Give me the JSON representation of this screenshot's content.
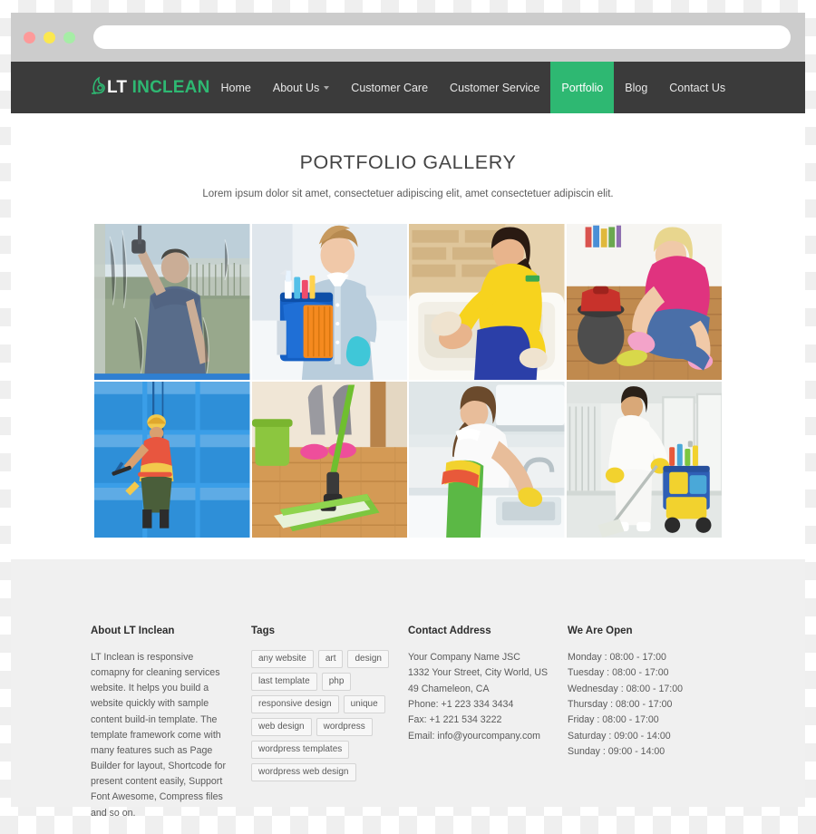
{
  "browser": {
    "dots": [
      "close-dot",
      "minimize-dot",
      "maximize-dot"
    ],
    "address_value": "",
    "address_placeholder": ""
  },
  "header": {
    "logo_icon": "vacuum-leaf-icon",
    "logo_primary": "LT",
    "logo_secondary": " INCLEAN",
    "accent_color": "#2eb872",
    "bar_color": "#3b3b3b",
    "nav": [
      {
        "label": "Home",
        "active": false,
        "dropdown": false
      },
      {
        "label": "About Us",
        "active": false,
        "dropdown": true
      },
      {
        "label": "Customer Care",
        "active": false,
        "dropdown": false
      },
      {
        "label": "Customer Service",
        "active": false,
        "dropdown": false
      },
      {
        "label": "Portfolio",
        "active": true,
        "dropdown": false
      },
      {
        "label": "Blog",
        "active": false,
        "dropdown": false
      },
      {
        "label": "Contact Us",
        "active": false,
        "dropdown": false
      }
    ]
  },
  "main": {
    "title": "PORTFOLIO GALLERY",
    "subtitle": "Lorem ipsum dolor sit amet, consectetuer adipiscing elit, amet consectetuer adipiscin elit.",
    "gallery": [
      {
        "name": "window-cleaner-squeegee-outdoor"
      },
      {
        "name": "maid-with-blue-bucket-and-supplies"
      },
      {
        "name": "woman-cleaning-bathtub-yellow-shirt"
      },
      {
        "name": "woman-scrubbing-wooden-floor-pink-shirt"
      },
      {
        "name": "rope-access-high-rise-window-washer"
      },
      {
        "name": "green-flat-mop-on-wooden-floor"
      },
      {
        "name": "woman-cleaning-kitchen-sink"
      },
      {
        "name": "janitor-mopping-with-cleaning-cart"
      }
    ]
  },
  "footer": {
    "about": {
      "title": "About LT Inclean",
      "text": "LT Inclean is responsive comapny for cleaning services website. It helps you build a website quickly with sample content build-in template. The template framework come with many features such as Page Builder for layout, Shortcode for present content easily, Support Font Awesome, Compress files and so on."
    },
    "tags": {
      "title": "Tags",
      "items": [
        "any website",
        "art",
        "design",
        "last template",
        "php",
        "responsive design",
        "unique",
        "web design",
        "wordpress",
        "wordpress templates",
        "wordpress web design"
      ]
    },
    "contact": {
      "title": "Contact Address",
      "lines": [
        "Your Company Name JSC",
        "1332 Your Street, City World, US",
        "49 Chameleon, CA",
        "Phone: +1 223 334 3434",
        "Fax: +1 221 534 3222",
        "Email: info@yourcompany.com"
      ]
    },
    "hours": {
      "title": "We Are Open",
      "lines": [
        "Monday : 08:00 - 17:00",
        "Tuesday : 08:00 - 17:00",
        "Wednesday : 08:00 - 17:00",
        "Thursday : 08:00 - 17:00",
        "Friday : 08:00 - 17:00",
        "Saturday : 09:00 - 14:00",
        "Sunday : 09:00 - 14:00"
      ]
    }
  }
}
